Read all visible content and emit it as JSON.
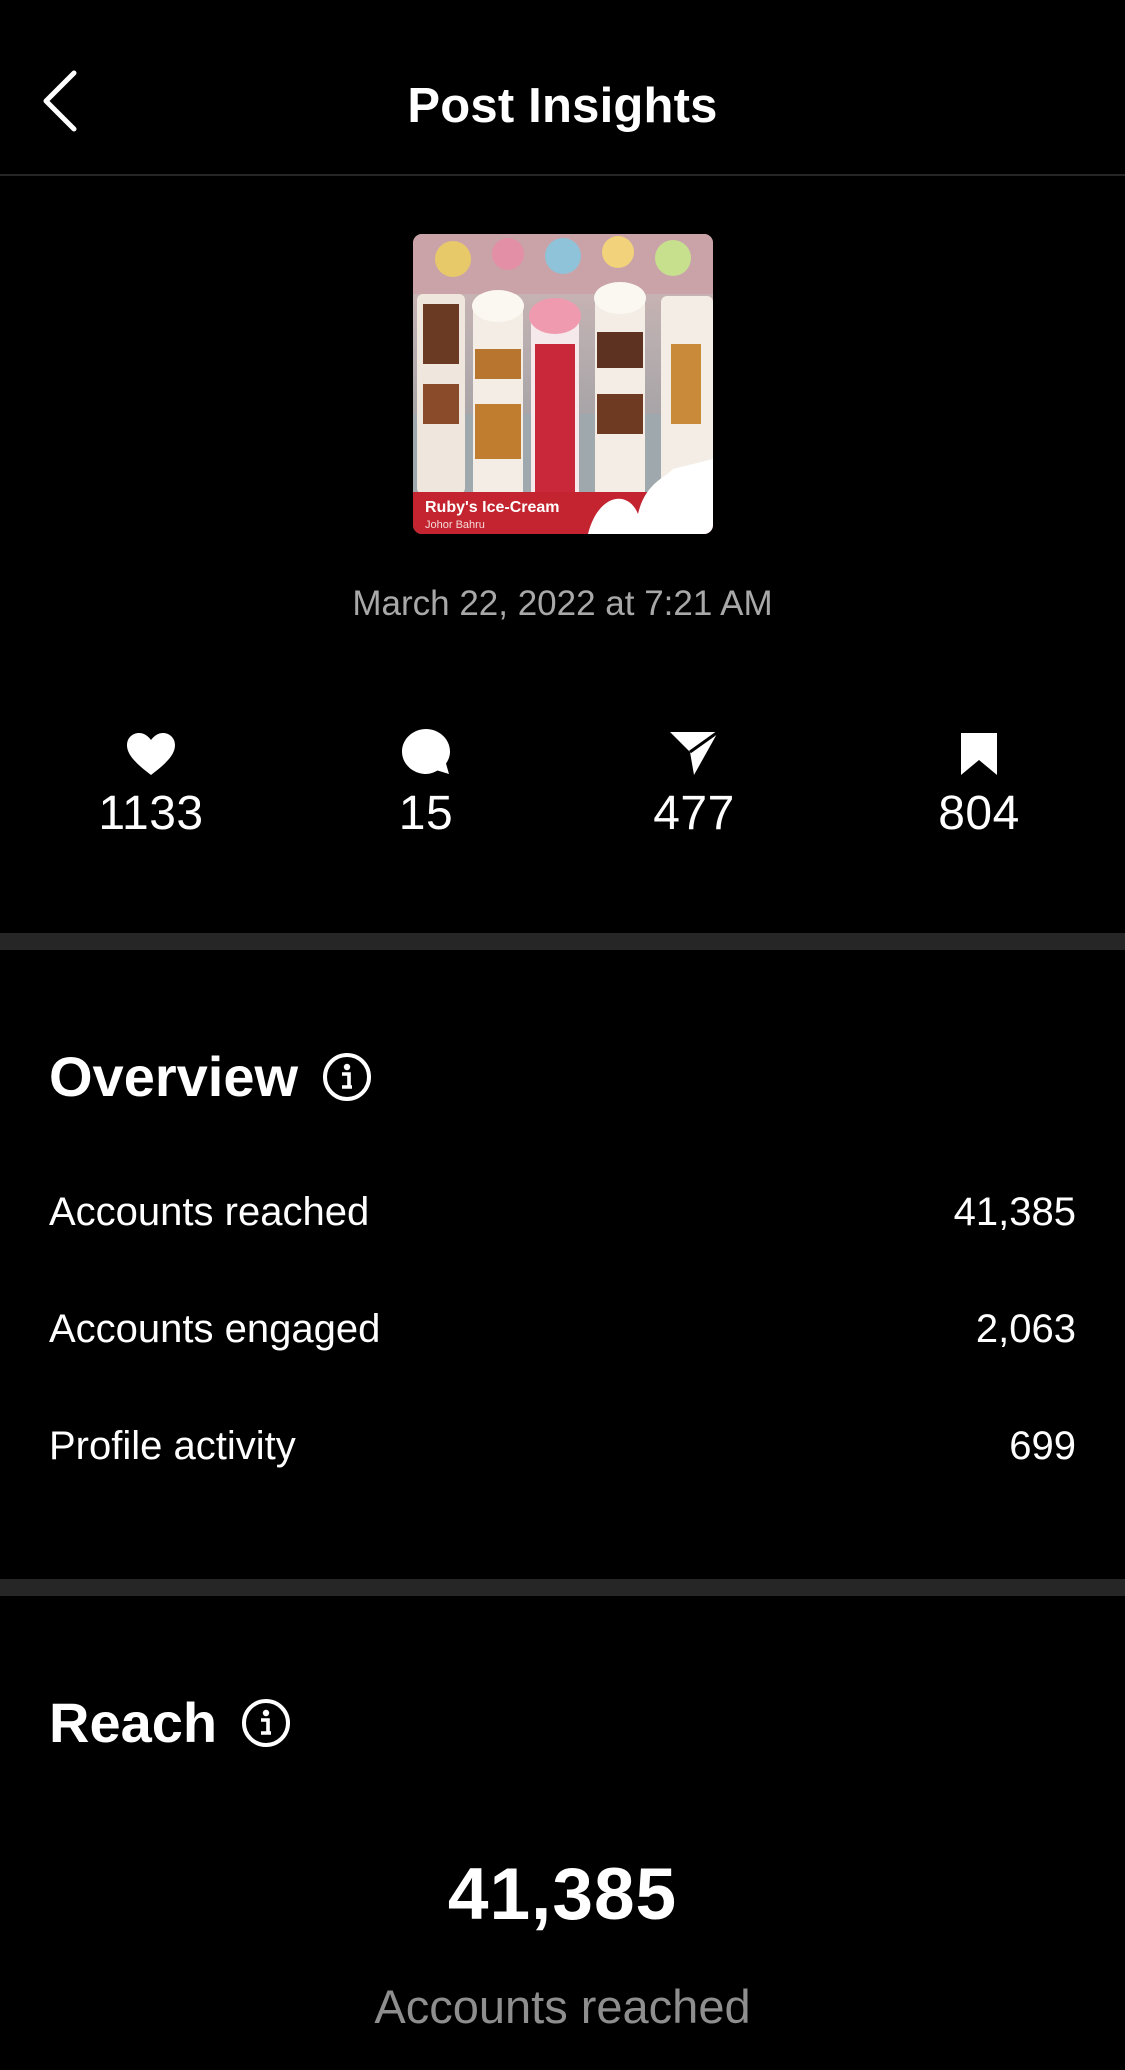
{
  "header": {
    "title": "Post Insights",
    "back_icon": "chevron-left-icon"
  },
  "post": {
    "thumbnail_caption": "Ruby's Ice-Cream",
    "thumbnail_subcaption": "Johor Bahru",
    "date": "March 22, 2022 at 7:21 AM"
  },
  "stats": {
    "likes": "1133",
    "comments": "15",
    "shares": "477",
    "saves": "804"
  },
  "overview": {
    "title": "Overview",
    "rows": [
      {
        "label": "Accounts reached",
        "value": "41,385"
      },
      {
        "label": "Accounts engaged",
        "value": "2,063"
      },
      {
        "label": "Profile activity",
        "value": "699"
      }
    ]
  },
  "reach": {
    "title": "Reach",
    "value": "41,385",
    "label": "Accounts reached"
  },
  "colors": {
    "background": "#000000",
    "divider": "#262626",
    "muted_text": "#a8a8a8"
  }
}
